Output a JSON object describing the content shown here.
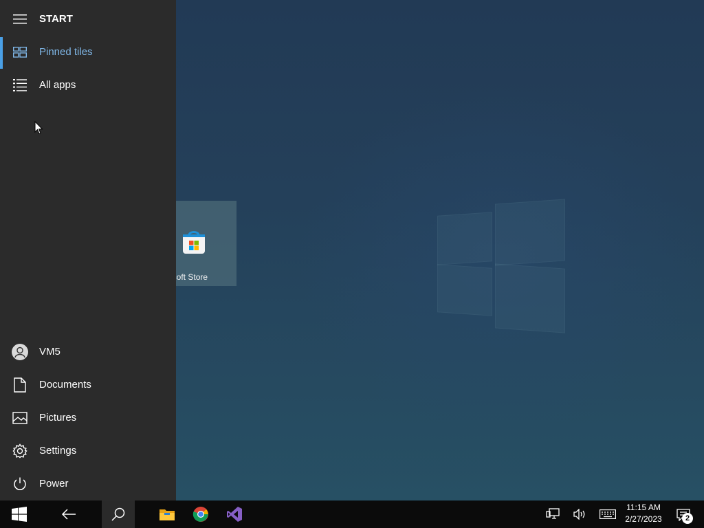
{
  "start_menu": {
    "title": "START",
    "nav": [
      {
        "label": "Pinned tiles",
        "icon": "pinned-tiles-icon",
        "active": true
      },
      {
        "label": "All apps",
        "icon": "all-apps-icon",
        "active": false
      }
    ],
    "bottom": [
      {
        "label": "VM5",
        "icon": "user-avatar-icon"
      },
      {
        "label": "Documents",
        "icon": "document-icon"
      },
      {
        "label": "Pictures",
        "icon": "pictures-icon"
      },
      {
        "label": "Settings",
        "icon": "gear-icon"
      },
      {
        "label": "Power",
        "icon": "power-icon"
      }
    ],
    "accent_color": "#4aa0e6"
  },
  "tiles": [
    {
      "label": "Microsoft Store",
      "visible_label": "osoft Store",
      "icon": "microsoft-store-icon"
    }
  ],
  "taskbar": {
    "apps": [
      {
        "name": "Start",
        "icon": "windows-start-icon"
      },
      {
        "name": "Back",
        "icon": "back-arrow-icon"
      },
      {
        "name": "Search",
        "icon": "search-icon"
      },
      {
        "name": "File Explorer",
        "icon": "file-explorer-icon"
      },
      {
        "name": "Google Chrome",
        "icon": "chrome-icon"
      },
      {
        "name": "Visual Studio",
        "icon": "visual-studio-icon"
      }
    ],
    "clock": {
      "time": "11:15 AM",
      "date": "2/27/2023"
    },
    "notification_count": "2"
  }
}
